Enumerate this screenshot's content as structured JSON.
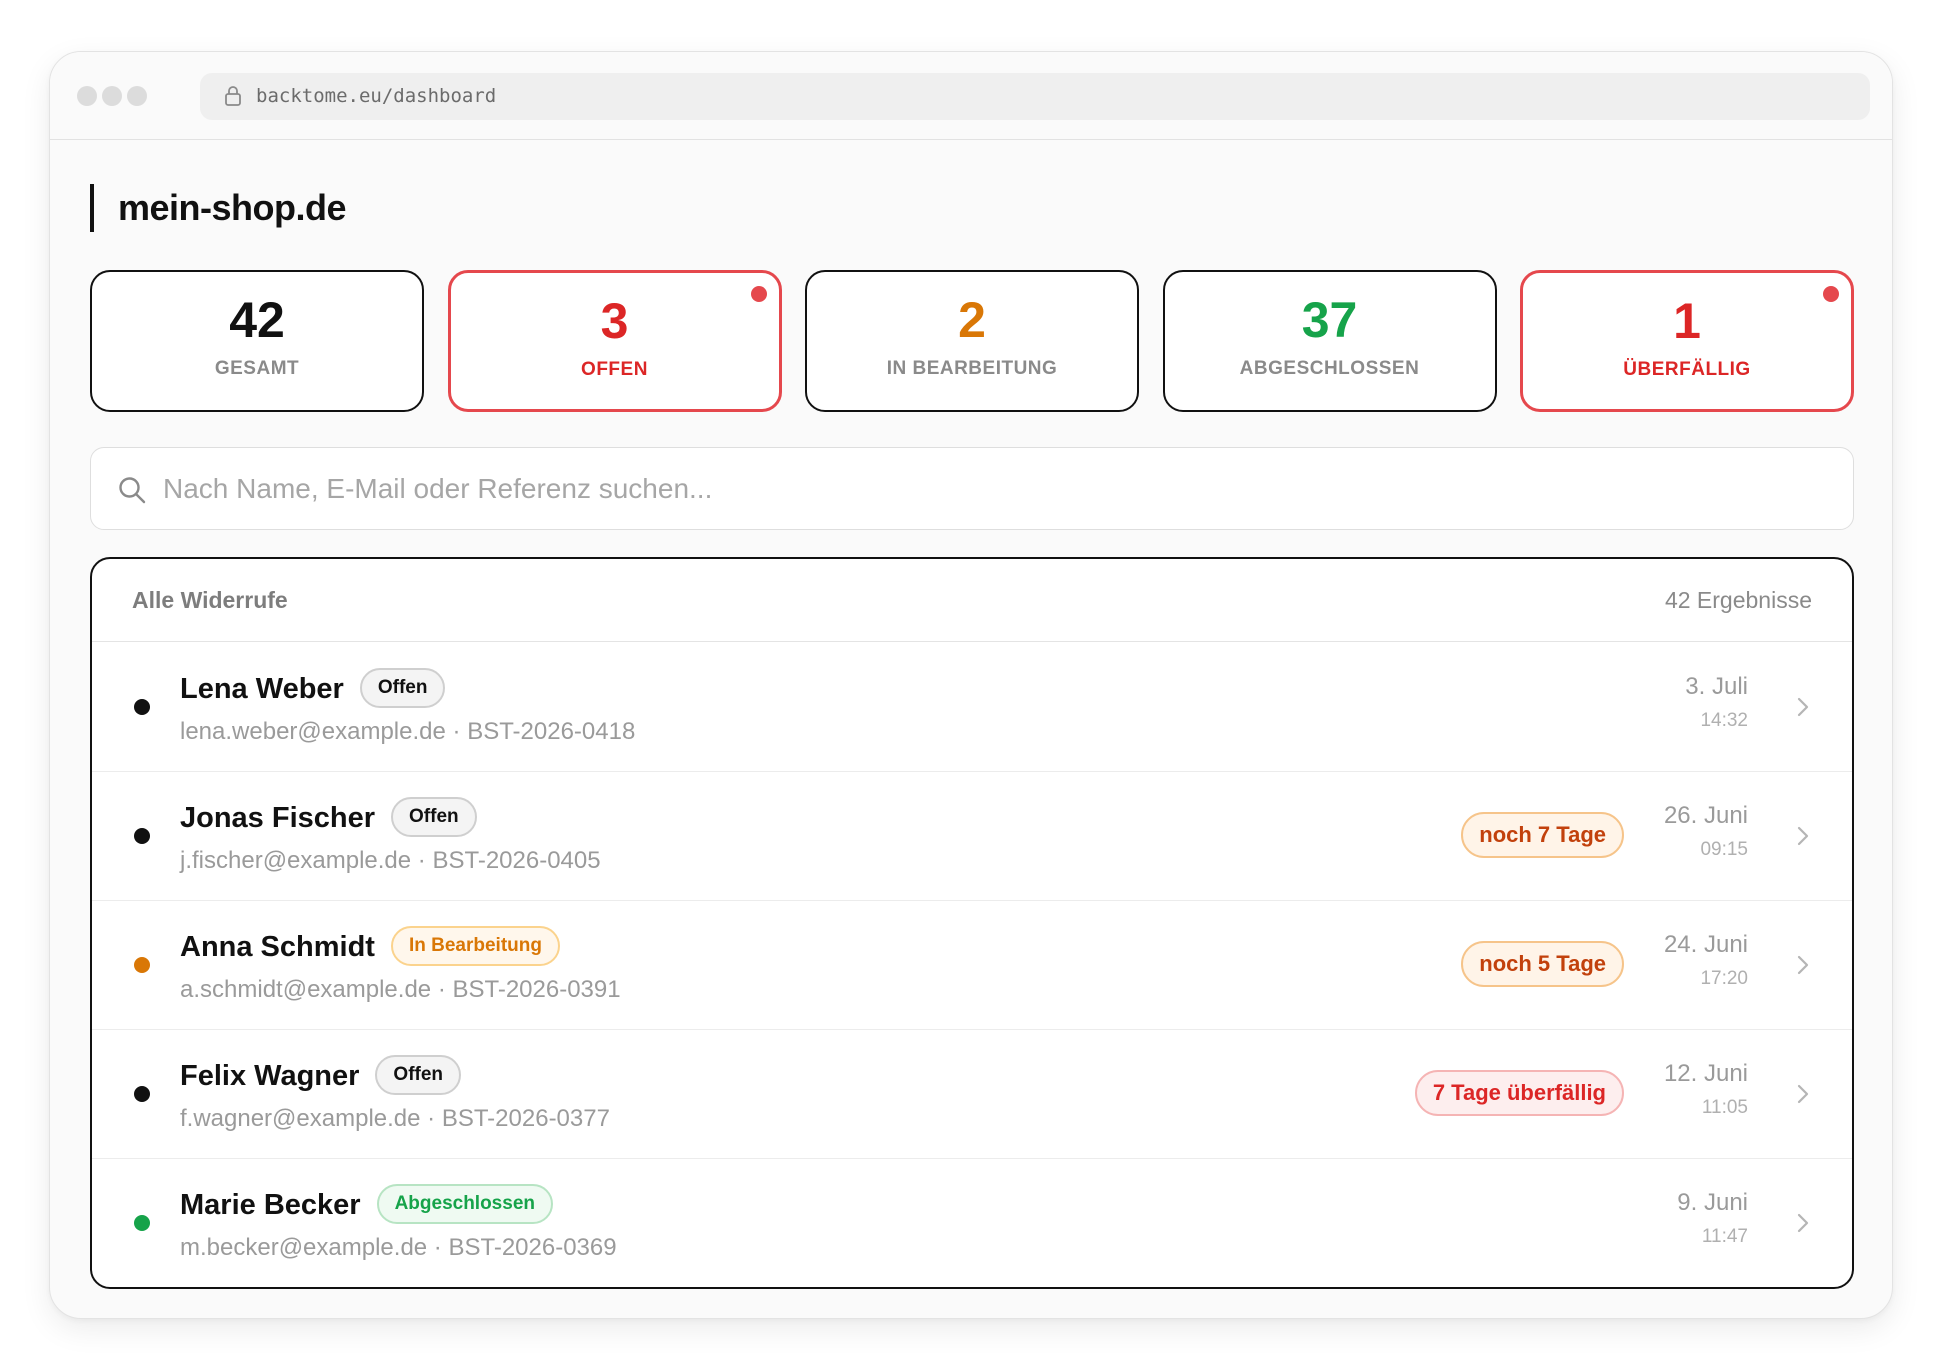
{
  "browser": {
    "url": "backtome.eu/dashboard"
  },
  "shop": {
    "title": "mein-shop.de"
  },
  "stats": [
    {
      "value": "42",
      "label": "GESAMT",
      "color": "#111111",
      "alert": false
    },
    {
      "value": "3",
      "label": "OFFEN",
      "color": "#dc2626",
      "alert": true
    },
    {
      "value": "2",
      "label": "IN BEARBEITUNG",
      "color": "#d97706",
      "alert": false
    },
    {
      "value": "37",
      "label": "ABGESCHLOSSEN",
      "color": "#16a34a",
      "alert": false
    },
    {
      "value": "1",
      "label": "ÜBERFÄLLIG",
      "color": "#dc2626",
      "alert": true
    }
  ],
  "search": {
    "placeholder": "Nach Name, E-Mail oder Referenz suchen..."
  },
  "list": {
    "title": "Alle Widerrufe",
    "count": "42 Ergebnisse",
    "rows": [
      {
        "name": "Lena Weber",
        "status": "Offen",
        "status_type": "open",
        "email": "lena.weber@example.de",
        "reference": "BST-2026-0418",
        "deadline": "",
        "deadline_type": "",
        "date": "3. Juli",
        "time": "14:32"
      },
      {
        "name": "Jonas Fischer",
        "status": "Offen",
        "status_type": "open",
        "email": "j.fischer@example.de",
        "reference": "BST-2026-0405",
        "deadline": "noch 7 Tage",
        "deadline_type": "warning",
        "date": "26. Juni",
        "time": "09:15"
      },
      {
        "name": "Anna Schmidt",
        "status": "In Bearbeitung",
        "status_type": "progress",
        "email": "a.schmidt@example.de",
        "reference": "BST-2026-0391",
        "deadline": "noch 5 Tage",
        "deadline_type": "warning",
        "date": "24. Juni",
        "time": "17:20"
      },
      {
        "name": "Felix Wagner",
        "status": "Offen",
        "status_type": "open",
        "email": "f.wagner@example.de",
        "reference": "BST-2026-0377",
        "deadline": "7 Tage überfällig",
        "deadline_type": "overdue",
        "date": "12. Juni",
        "time": "11:05"
      },
      {
        "name": "Marie Becker",
        "status": "Abgeschlossen",
        "status_type": "done",
        "email": "m.becker@example.de",
        "reference": "BST-2026-0369",
        "deadline": "",
        "deadline_type": "",
        "date": "9. Juni",
        "time": "11:47"
      }
    ]
  },
  "colors": {
    "alert_border": "#e5484d",
    "open_dot": "#111111",
    "progress_dot": "#d97706",
    "done_dot": "#16a34a"
  },
  "icons": {
    "lock": "lock-icon",
    "search": "search-icon",
    "chevron": "chevron-right-icon"
  }
}
